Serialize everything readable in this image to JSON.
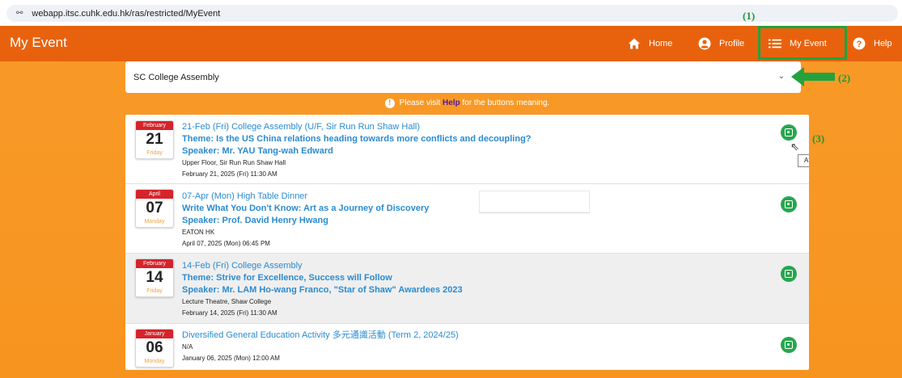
{
  "browser": {
    "url": "webapp.itsc.cuhk.edu.hk/ras/restricted/MyEvent"
  },
  "header": {
    "title": "My Event",
    "nav": {
      "home": "Home",
      "profile": "Profile",
      "my_event": "My Event",
      "help": "Help"
    }
  },
  "callouts": {
    "one": "(1)",
    "two": "(2)",
    "three": "(3)"
  },
  "selector": {
    "value": "SC College Assembly"
  },
  "notice": {
    "before": "Please visit ",
    "link": "Help",
    "after": " for the buttons meaning."
  },
  "events": [
    {
      "cal_month": "February",
      "cal_day": "21",
      "cal_weekday": "Friday",
      "title": "21-Feb (Fri) College Assembly (U/F, Sir Run Run Shaw Hall)",
      "theme": "Theme: Is the US China relations heading towards more conflicts and decoupling?",
      "speaker": "Speaker: Mr. YAU Tang-wah Edward",
      "venue": "Upper Floor, Sir Run Run Shaw Hall",
      "datetime": "February 21, 2025 (Fri) 11:30 AM",
      "tooltip": "Attended"
    },
    {
      "cal_month": "April",
      "cal_day": "07",
      "cal_weekday": "Monday",
      "title": "07-Apr (Mon) High Table Dinner",
      "theme": "Write What You Don't Know: Art as a Journey of Discovery",
      "speaker": "Speaker: Prof. David Henry Hwang",
      "venue": "EATON HK",
      "datetime": "April 07, 2025 (Mon) 06:45 PM"
    },
    {
      "cal_month": "February",
      "cal_day": "14",
      "cal_weekday": "Friday",
      "title": "14-Feb (Fri) College Assembly",
      "theme": "Theme: Strive for Excellence, Success will Follow",
      "speaker": "Speaker: Mr. LAM Ho-wang Franco, \"Star of Shaw\" Awardees 2023",
      "venue": "Lecture Theatre, Shaw College",
      "datetime": "February 14, 2025 (Fri) 11:30 AM"
    },
    {
      "cal_month": "January",
      "cal_day": "06",
      "cal_weekday": "Monday",
      "title": "Diversified General Education Activity 多元通識活動 (Term 2, 2024/25)",
      "venue": "N/A",
      "datetime": "January 06, 2025 (Mon) 12:00 AM"
    }
  ],
  "colors": {
    "header": "#e8620e",
    "page": "#f7941f",
    "link": "#2b8bd0",
    "attended": "#27a64f",
    "callout": "#23a23d"
  }
}
